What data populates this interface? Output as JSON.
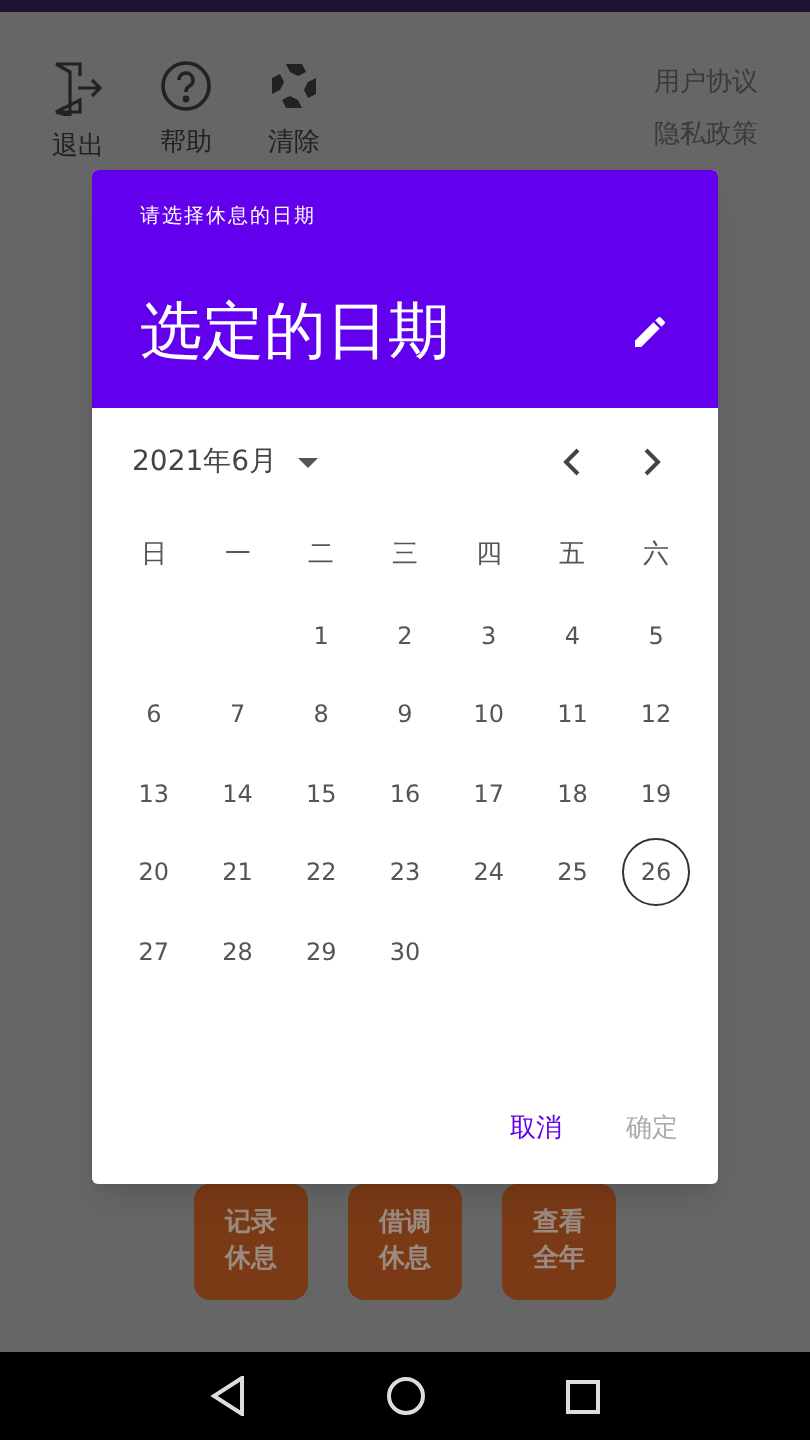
{
  "toolbar": {
    "actions": [
      {
        "kind": "exit",
        "label": "退出"
      },
      {
        "kind": "help",
        "label": "帮助"
      },
      {
        "kind": "clear",
        "label": "清除"
      }
    ],
    "links": [
      "用户协议",
      "隐私政策"
    ]
  },
  "bottom_buttons": [
    {
      "label": "记录休息"
    },
    {
      "label": "借调休息"
    },
    {
      "label": "查看全年"
    }
  ],
  "dialog": {
    "subtitle": "请选择休息的日期",
    "title": "选定的日期",
    "month": "2021年6月",
    "weekdays": [
      "日",
      "一",
      "二",
      "三",
      "四",
      "五",
      "六"
    ],
    "weeks": [
      {
        "days": [
          {
            "kind": "blank"
          },
          {
            "kind": "blank"
          },
          {
            "kind": "day",
            "label": "1",
            "today": false
          },
          {
            "kind": "day",
            "label": "2",
            "today": false
          },
          {
            "kind": "day",
            "label": "3",
            "today": false
          },
          {
            "kind": "day",
            "label": "4",
            "today": false
          },
          {
            "kind": "day",
            "label": "5",
            "today": false
          }
        ]
      },
      {
        "days": [
          {
            "kind": "day",
            "label": "6",
            "today": false
          },
          {
            "kind": "day",
            "label": "7",
            "today": false
          },
          {
            "kind": "day",
            "label": "8",
            "today": false
          },
          {
            "kind": "day",
            "label": "9",
            "today": false
          },
          {
            "kind": "day",
            "label": "10",
            "today": false
          },
          {
            "kind": "day",
            "label": "11",
            "today": false
          },
          {
            "kind": "day",
            "label": "12",
            "today": false
          }
        ]
      },
      {
        "days": [
          {
            "kind": "day",
            "label": "13",
            "today": false
          },
          {
            "kind": "day",
            "label": "14",
            "today": false
          },
          {
            "kind": "day",
            "label": "15",
            "today": false
          },
          {
            "kind": "day",
            "label": "16",
            "today": false
          },
          {
            "kind": "day",
            "label": "17",
            "today": false
          },
          {
            "kind": "day",
            "label": "18",
            "today": false
          },
          {
            "kind": "day",
            "label": "19",
            "today": false
          }
        ]
      },
      {
        "days": [
          {
            "kind": "day",
            "label": "20",
            "today": false
          },
          {
            "kind": "day",
            "label": "21",
            "today": false
          },
          {
            "kind": "day",
            "label": "22",
            "today": false
          },
          {
            "kind": "day",
            "label": "23",
            "today": false
          },
          {
            "kind": "day",
            "label": "24",
            "today": false
          },
          {
            "kind": "day",
            "label": "25",
            "today": false
          },
          {
            "kind": "day",
            "label": "26",
            "today": true
          }
        ]
      },
      {
        "days": [
          {
            "kind": "day",
            "label": "27",
            "today": false
          },
          {
            "kind": "day",
            "label": "28",
            "today": false
          },
          {
            "kind": "day",
            "label": "29",
            "today": false
          },
          {
            "kind": "day",
            "label": "30",
            "today": false
          }
        ]
      }
    ],
    "cancel": {
      "label": "取消",
      "disabled": false
    },
    "confirm": {
      "label": "确定",
      "disabled": true
    }
  }
}
